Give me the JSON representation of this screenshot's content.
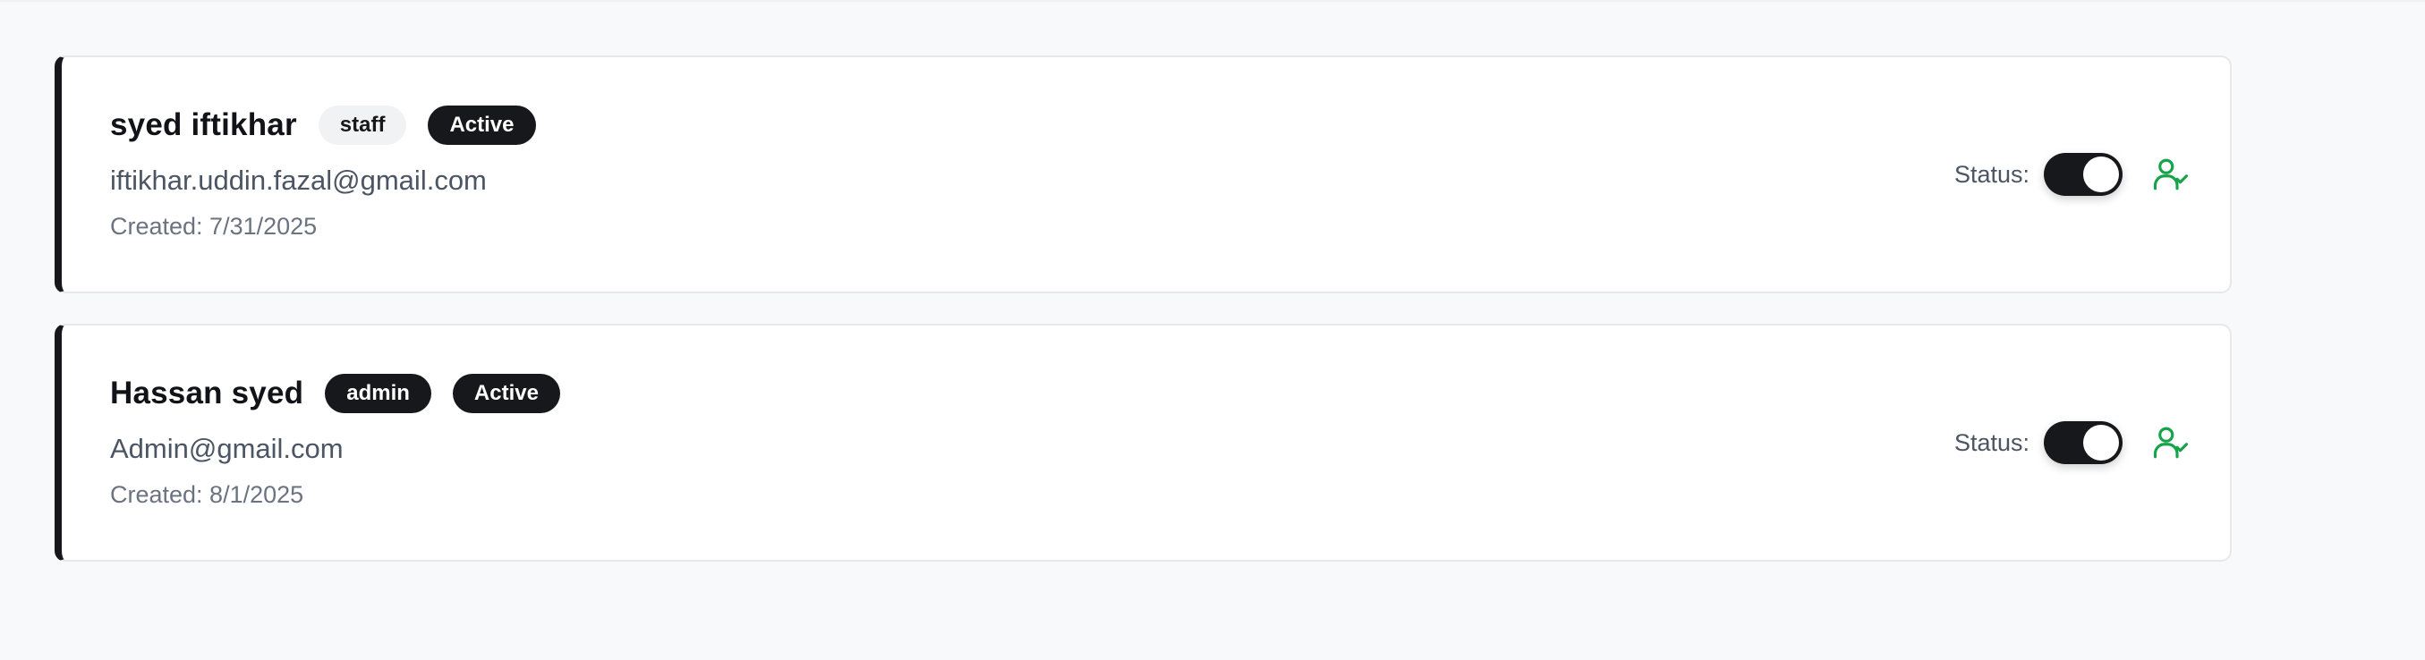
{
  "colors": {
    "accent_dark": "#17181b",
    "success_green": "#16a34a",
    "page_bg": "#f8f9fb"
  },
  "users": [
    {
      "name": "syed iftikhar",
      "role": "staff",
      "role_style": "light",
      "state": "Active",
      "email": "iftikhar.uddin.fazal@gmail.com",
      "created": "Created: 7/31/2025",
      "status_label": "Status:",
      "status_on": true,
      "action_icon": "user-check-icon"
    },
    {
      "name": "Hassan syed",
      "role": "admin",
      "role_style": "dark",
      "state": "Active",
      "email": "Admin@gmail.com",
      "created": "Created: 8/1/2025",
      "status_label": "Status:",
      "status_on": true,
      "action_icon": "user-check-icon"
    }
  ]
}
